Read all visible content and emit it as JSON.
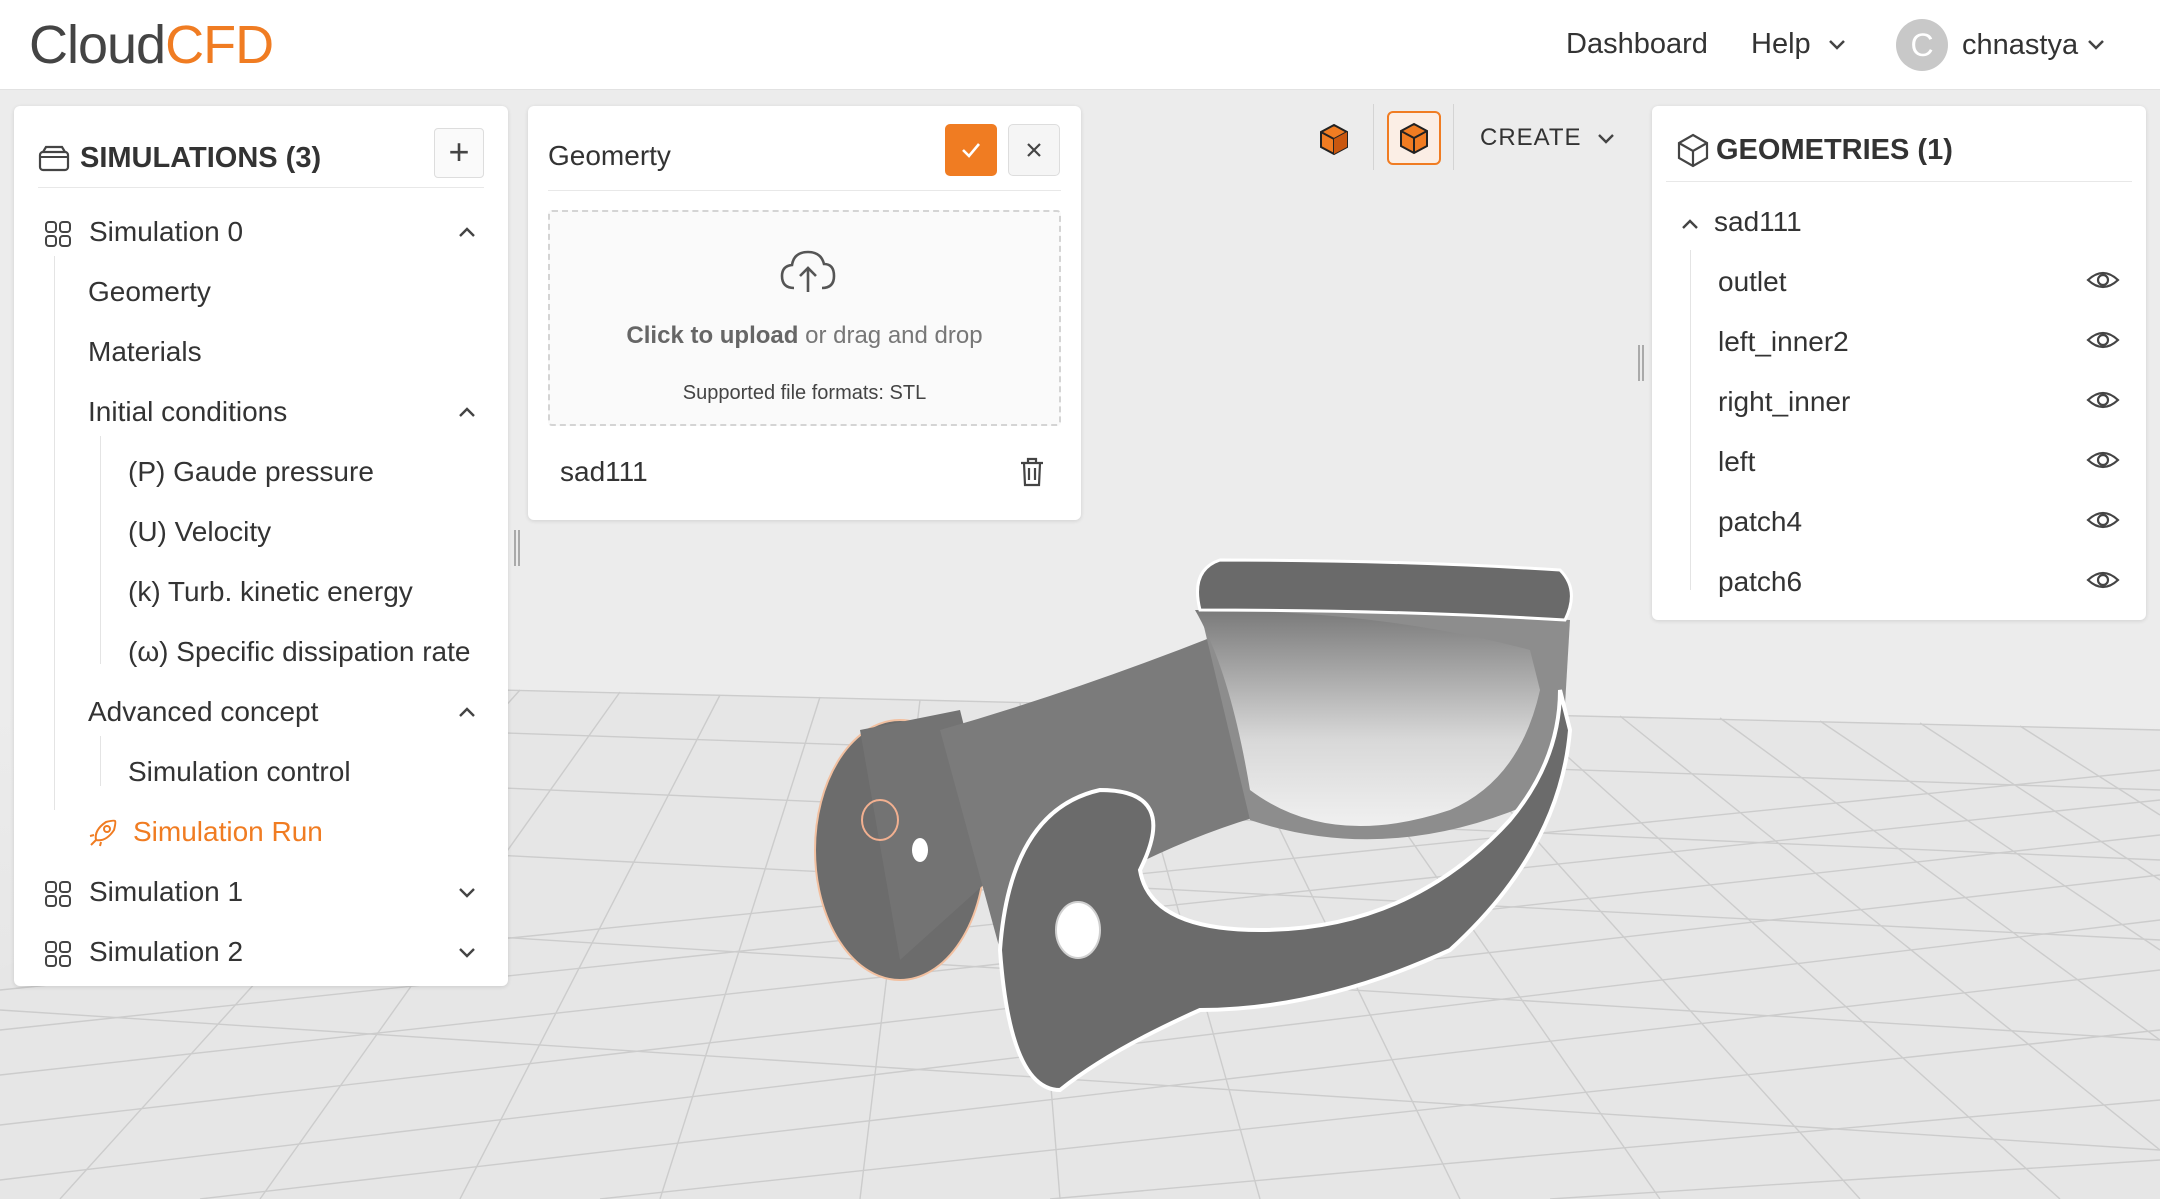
{
  "header": {
    "logo_part1": "Cloud",
    "logo_part2": "CFD",
    "nav_dashboard": "Dashboard",
    "nav_help": "Help",
    "user_initial": "C",
    "username": "chnastya"
  },
  "simulations": {
    "title": "SIMULATIONS (3)",
    "add_label": "+",
    "sim0": {
      "label": "Simulation 0",
      "geometry": "Geomerty",
      "materials": "Materials",
      "initial_conditions": "Initial conditions",
      "ic_items": [
        "(P) Gaude pressure",
        "(U) Velocity",
        "(k) Turb. kinetic energy",
        "(ω) Specific dissipation rate"
      ],
      "advanced": "Advanced concept",
      "sim_control": "Simulation control",
      "sim_run": "Simulation Run"
    },
    "sim1": "Simulation 1",
    "sim2": "Simulation 2"
  },
  "geometry_panel": {
    "title": "Geomerty",
    "upload_strong": "Click to upload",
    "upload_rest": " or drag and drop",
    "formats": "Supported file formats: STL",
    "file_name": "sad111"
  },
  "toolbar": {
    "create_label": "CREATE"
  },
  "geometries": {
    "title": "GEOMETRIES (1)",
    "root": "sad111",
    "items": [
      "outlet",
      "left_inner2",
      "right_inner",
      "left",
      "patch4",
      "patch6"
    ]
  },
  "colors": {
    "accent": "#f07c22",
    "text": "#333333",
    "viewport_bg": "#ececec"
  }
}
